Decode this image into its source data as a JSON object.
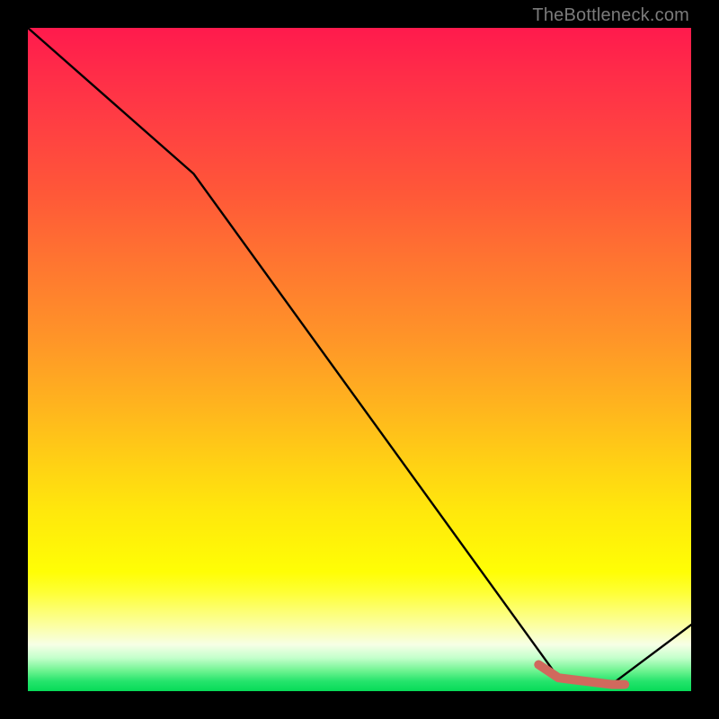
{
  "watermark": "TheBottleneck.com",
  "chart_data": {
    "type": "line",
    "title": "",
    "xlabel": "",
    "ylabel": "",
    "xlim": [
      0,
      100
    ],
    "ylim": [
      0,
      100
    ],
    "grid": false,
    "legend": false,
    "series": [
      {
        "name": "bottleneck-curve",
        "x": [
          0,
          25,
          80,
          88,
          100
        ],
        "values": [
          100,
          78,
          2,
          1,
          10
        ]
      }
    ],
    "highlight": {
      "name": "optimal-range",
      "x": [
        77,
        80,
        88,
        90
      ],
      "values": [
        4,
        2,
        1,
        1
      ]
    },
    "gradient_colors": {
      "top": "#ff1a4d",
      "mid_orange": "#ff9528",
      "mid_yellow": "#fff408",
      "bottom": "#07db58"
    }
  }
}
